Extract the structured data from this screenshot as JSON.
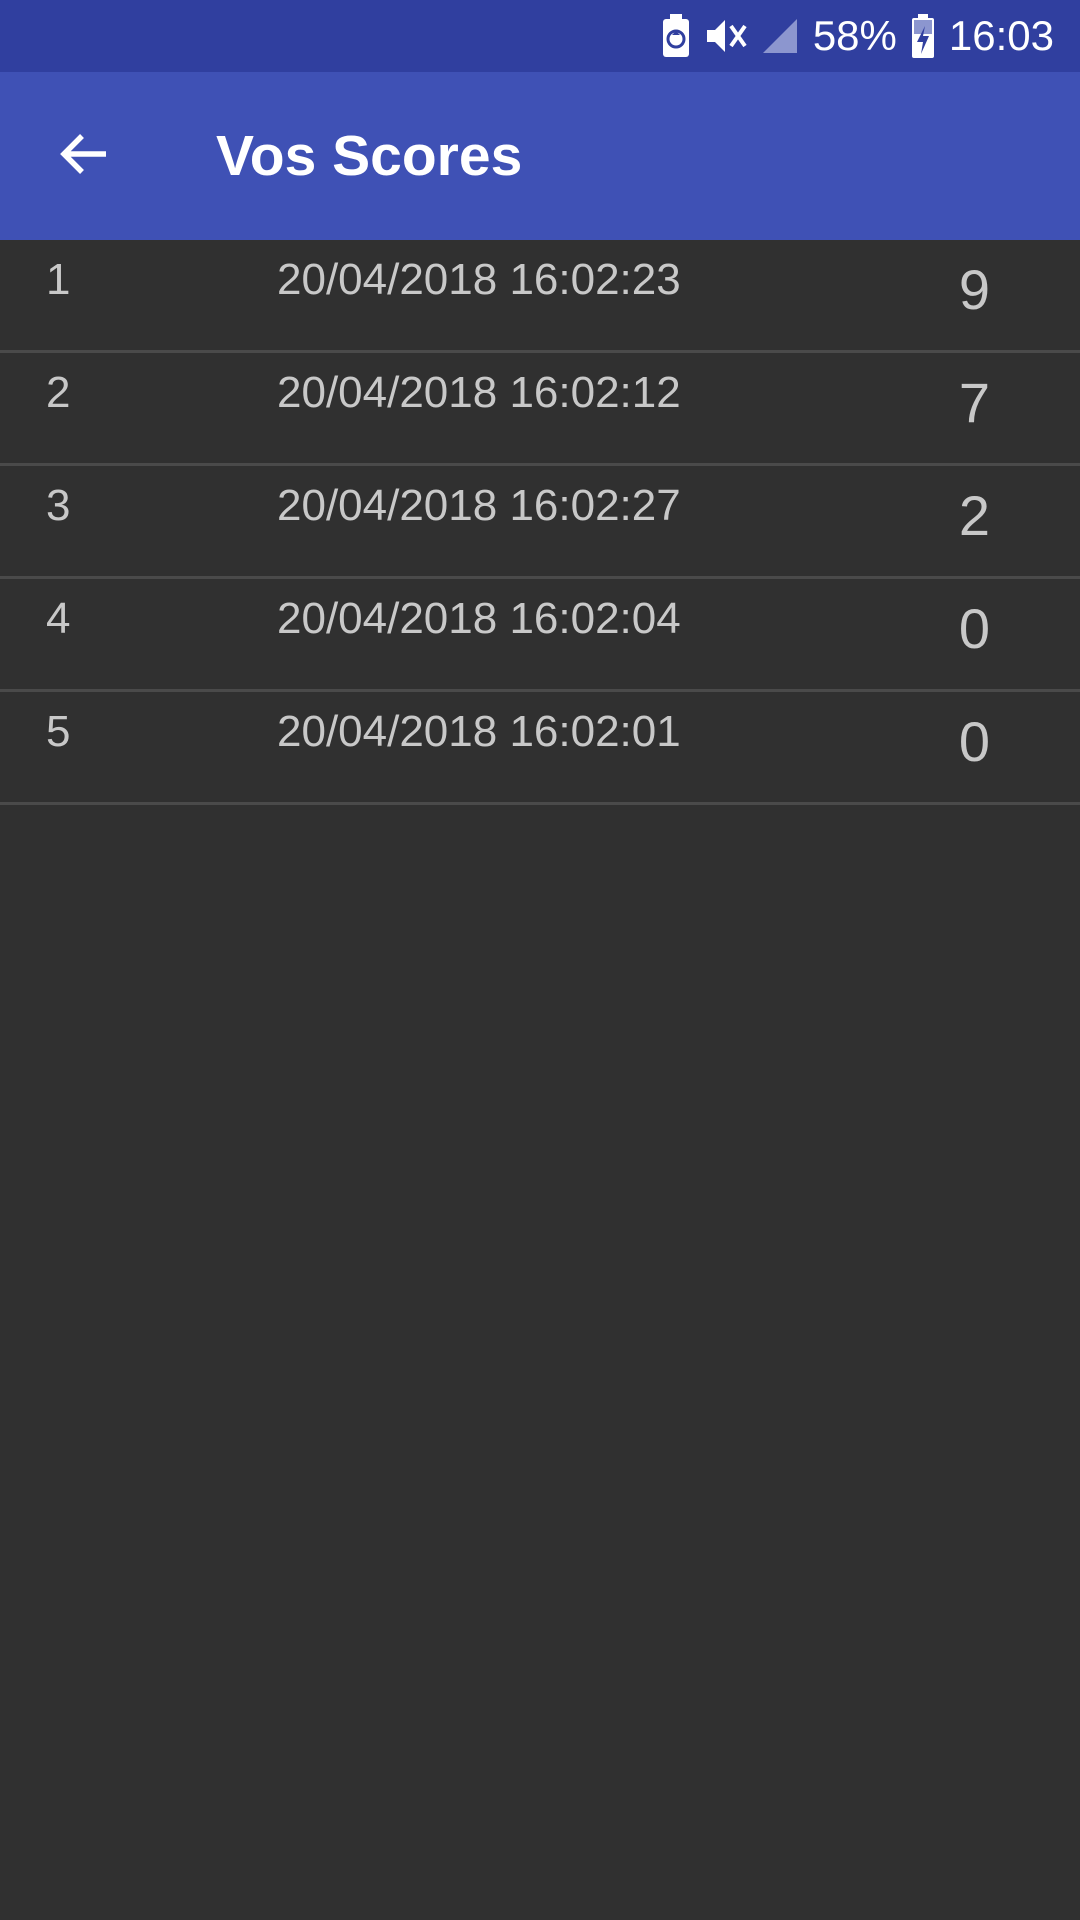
{
  "status_bar": {
    "battery_percent": "58%",
    "time": "16:03",
    "icons": [
      "battery-saver-icon",
      "vibrate-mute-icon",
      "cell-signal-icon",
      "battery-charging-icon"
    ]
  },
  "app_bar": {
    "title": "Vos Scores",
    "back_icon": "arrow-back-icon"
  },
  "scores": [
    {
      "rank": "1",
      "date": "20/04/2018 16:02:23",
      "score": "9"
    },
    {
      "rank": "2",
      "date": "20/04/2018 16:02:12",
      "score": "7"
    },
    {
      "rank": "3",
      "date": "20/04/2018 16:02:27",
      "score": "2"
    },
    {
      "rank": "4",
      "date": "20/04/2018 16:02:04",
      "score": "0"
    },
    {
      "rank": "5",
      "date": "20/04/2018 16:02:01",
      "score": "0"
    }
  ],
  "colors": {
    "status_bar": "#303F9F",
    "app_bar": "#3F51B5",
    "background": "#303030",
    "text": "#C8C8C8",
    "divider": "#4A4A4A"
  }
}
